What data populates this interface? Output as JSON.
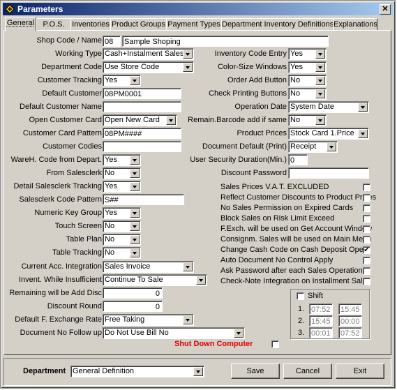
{
  "window": {
    "title": "Parameters",
    "close_label": "✕"
  },
  "tabs": [
    "General",
    "P.O.S.",
    "Inventories",
    "Product Groups",
    "Payment Types",
    "Department Inventory Definitions",
    "Explanations"
  ],
  "shop": {
    "label": "Shop Code / Name",
    "code": "08",
    "name": "Sample Shoping"
  },
  "left": {
    "working_type": {
      "label": "Working Type",
      "value": "Cash+Instalment Sales"
    },
    "department_code": {
      "label": "Department Code",
      "value": "Use Store Code"
    },
    "customer_tracking": {
      "label": "Customer Tracking",
      "value": "Yes"
    },
    "default_customer": {
      "label": "Default Customer",
      "value": "08PM0001"
    },
    "default_customer_name": {
      "label": "Default Customer Name",
      "value": ""
    },
    "open_customer_card": {
      "label": "Open Customer Card",
      "value": "Open New Card"
    },
    "customer_card_pattern": {
      "label": "Customer Card Pattern",
      "value": "08PM####"
    },
    "customer_codies": {
      "label": "Customer Codies",
      "value": ""
    },
    "wareh_code": {
      "label": "WareH. Code from Depart.",
      "value": "Yes"
    },
    "from_salesclerk": {
      "label": "From Salesclerk",
      "value": "No"
    },
    "detail_salesclerk": {
      "label": "Detail Salesclerk Tracking",
      "value": "Yes"
    },
    "salesclerk_pattern": {
      "label": "Salesclerk Code Pattern",
      "value": "S##"
    },
    "numeric_key_group": {
      "label": "Numeric Key Group",
      "value": "Yes"
    },
    "touch_screen": {
      "label": "Touch Screen",
      "value": "No"
    },
    "table_plan": {
      "label": "Table Plan",
      "value": "No"
    },
    "table_tracking": {
      "label": "Table Tracking",
      "value": "No"
    },
    "current_acc": {
      "label": "Current Acc. Integration",
      "value": "Sales Invoice"
    },
    "invent_insufficient": {
      "label": "Invent. While Insufficient",
      "value": "Continue To Sale"
    },
    "remaining_disc": {
      "label": "Remaining will be Add Disc",
      "value": "0"
    },
    "discount_round": {
      "label": "Discount Round",
      "value": "0"
    },
    "default_fx_rate": {
      "label": "Default F. Exchange Rate",
      "value": "Free Taking"
    },
    "document_no_follow": {
      "label": "Document No Follow up",
      "value": "Do Not Use Bill No"
    }
  },
  "right": {
    "inventory_code_entry": {
      "label": "Inventory Code Entry",
      "value": "Yes"
    },
    "color_size_windows": {
      "label": "Color-Size Windows",
      "value": "Yes"
    },
    "order_add_button": {
      "label": "Order Add Button",
      "value": "No"
    },
    "check_printing_buttons": {
      "label": "Check Printing Buttons",
      "value": "No"
    },
    "operation_date": {
      "label": "Operation Date",
      "value": "System Date"
    },
    "remain_barcode": {
      "label": "Remain.Barcode add if same",
      "value": "No"
    },
    "product_prices": {
      "label": "Product Prices",
      "value": "Stock Card 1.Price"
    },
    "document_default": {
      "label": "Document Default (Print)",
      "value": "Receipt"
    },
    "user_security": {
      "label": "User Security Duration(Min.)",
      "value": "0"
    },
    "discount_password": {
      "label": "Discount Password",
      "value": ""
    }
  },
  "checkboxes": [
    {
      "label": "Sales Prices V.A.T. EXCLUDED",
      "checked": false
    },
    {
      "label": "Reflect Customer Discounts to Product Prices",
      "checked": false
    },
    {
      "label": "No Sales Permission on Expired Cards",
      "checked": false
    },
    {
      "label": "Block Sales on Risk Limit Exceed",
      "checked": false
    },
    {
      "label": "F.Exch. will be used on Get Account Window",
      "checked": false
    },
    {
      "label": "Consignm. Sales will be used on Main Menu",
      "checked": false
    },
    {
      "label": "Change Cash Code on Cash Deposit Ope.",
      "checked": true
    },
    {
      "label": "Auto Document No Control Apply",
      "checked": false
    },
    {
      "label": "Ask Password after each Sales Operation",
      "checked": false
    },
    {
      "label": "Check-Note Integration on Installment Sales",
      "checked": false
    }
  ],
  "shift": {
    "label": "Shift",
    "rows": [
      {
        "num": "1.",
        "start": "07:52",
        "end": "15:45"
      },
      {
        "num": "2.",
        "start": "15:45",
        "end": "00:00"
      },
      {
        "num": "3.",
        "start": "00:01",
        "end": "07:52"
      }
    ]
  },
  "shutdown": {
    "label": "Shut Down Computer"
  },
  "bottom": {
    "department_label": "Department",
    "department_value": "General Definition",
    "save": "Save",
    "cancel": "Cancel",
    "exit": "Exit"
  },
  "colors": {
    "titlebar_start": "#0a246a",
    "titlebar_end": "#a6caf0",
    "face": "#d4d0c8",
    "shutdown_red": "#e00000"
  }
}
